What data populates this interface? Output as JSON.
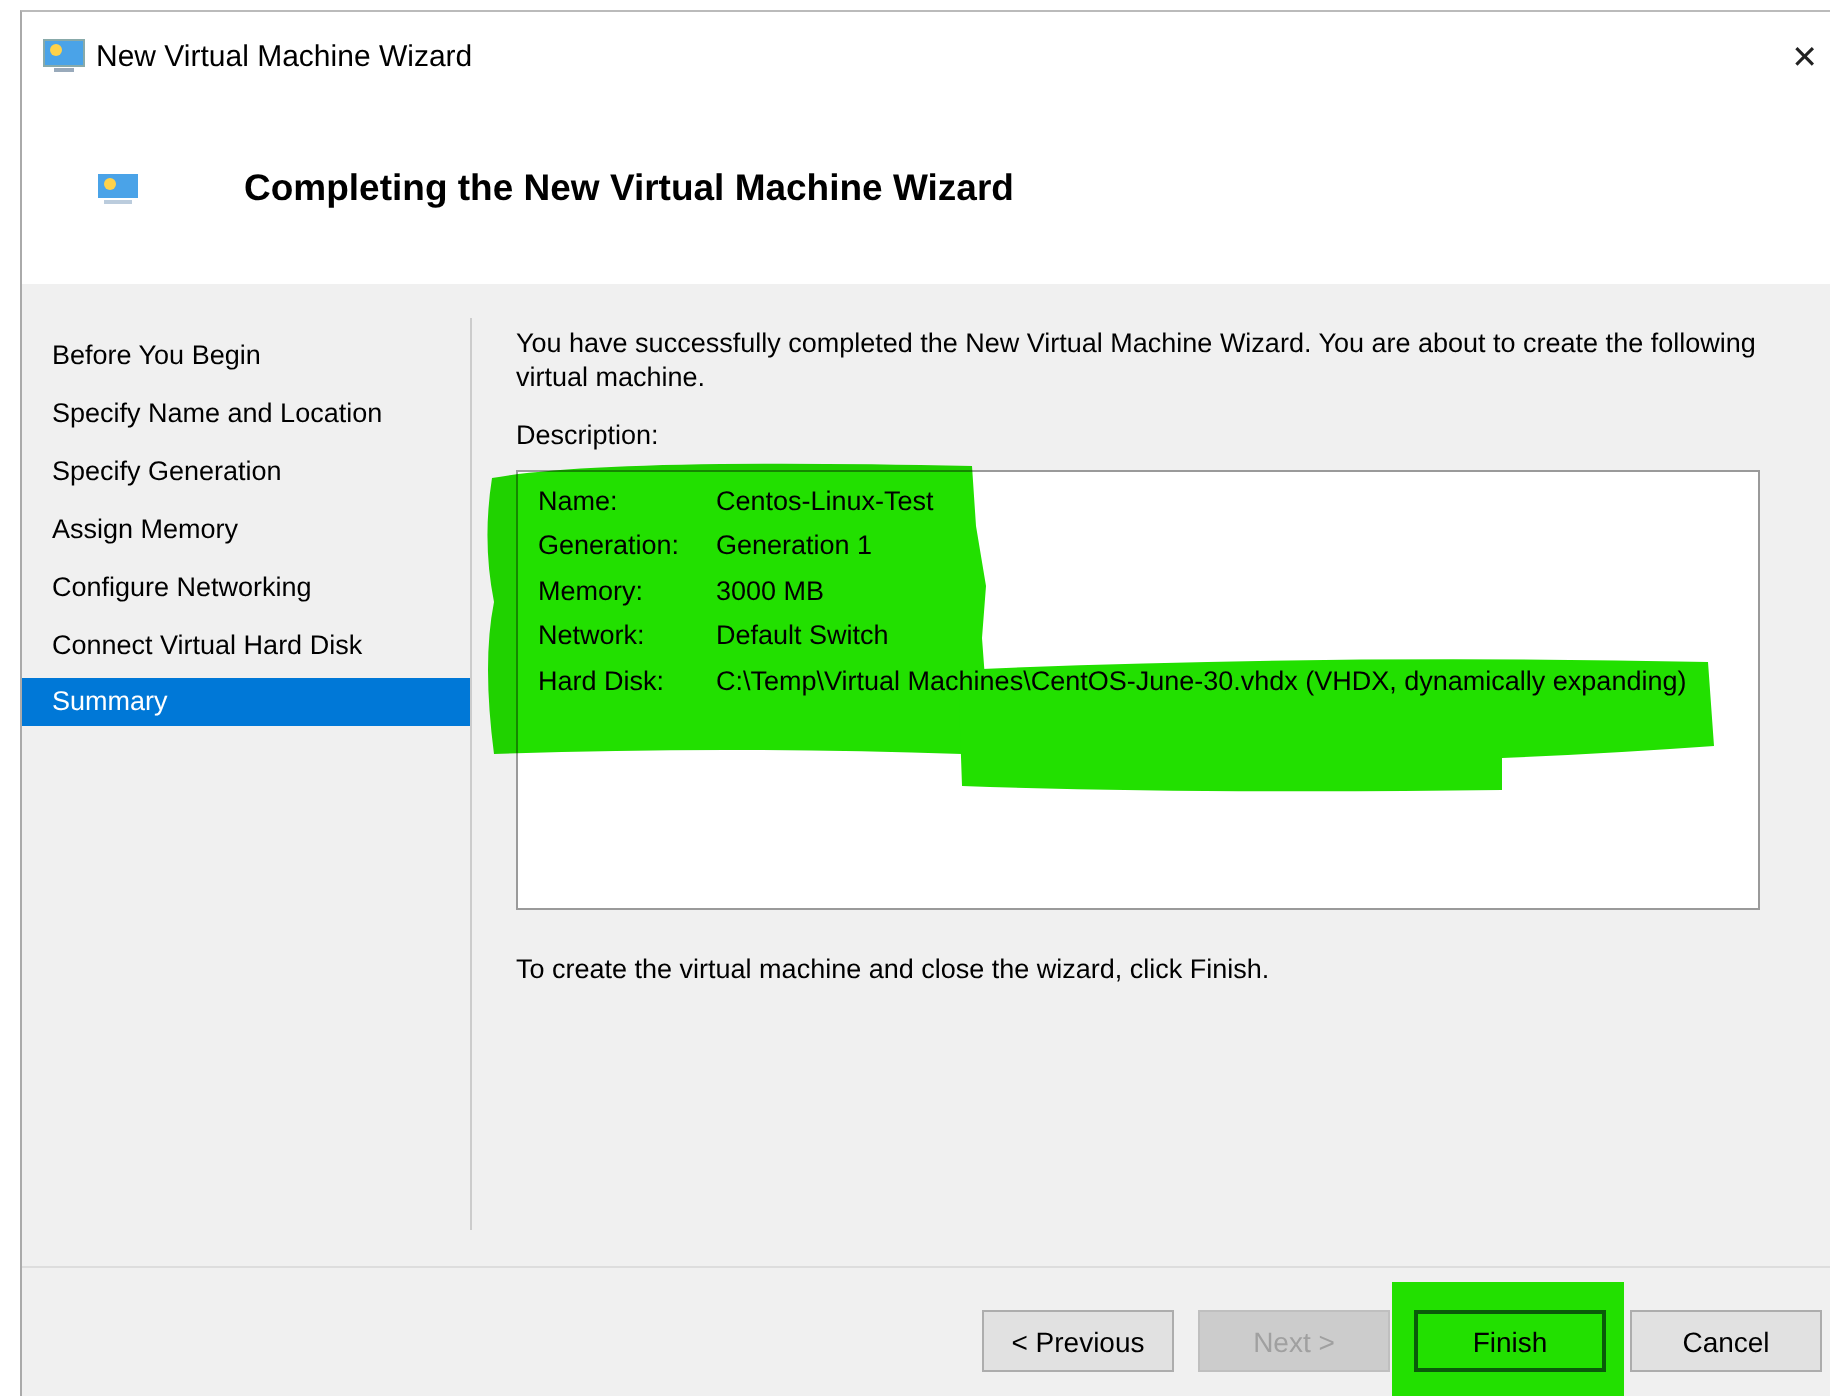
{
  "window": {
    "title": "New Virtual Machine Wizard",
    "close": "✕"
  },
  "header": {
    "title": "Completing the New Virtual Machine Wizard"
  },
  "steps": [
    {
      "label": "Before You Begin",
      "selected": false
    },
    {
      "label": "Specify Name and Location",
      "selected": false
    },
    {
      "label": "Specify Generation",
      "selected": false
    },
    {
      "label": "Assign Memory",
      "selected": false
    },
    {
      "label": "Configure Networking",
      "selected": false
    },
    {
      "label": "Connect Virtual Hard Disk",
      "selected": false
    },
    {
      "label": "Summary",
      "selected": true
    }
  ],
  "intro": "You have successfully completed the New Virtual Machine Wizard. You are about to create the following virtual machine.",
  "description": {
    "label": "Description:",
    "rows": [
      {
        "key": "Name:",
        "value": "Centos-Linux-Test"
      },
      {
        "key": "Generation:",
        "value": "Generation 1"
      },
      {
        "key": "Memory:",
        "value": "3000 MB"
      },
      {
        "key": "Network:",
        "value": "Default Switch"
      },
      {
        "key": "Hard Disk:",
        "value": "C:\\Temp\\Virtual Machines\\CentOS-June-30.vhdx (VHDX, dynamically expanding)"
      }
    ]
  },
  "footer_text": "To create the virtual machine and close the wizard, click Finish.",
  "buttons": [
    {
      "label": "< Previous",
      "disabled": false,
      "default": false
    },
    {
      "label": "Next >",
      "disabled": true,
      "default": false
    },
    {
      "label": "Finish",
      "disabled": false,
      "default": true,
      "marked": true
    },
    {
      "label": "Cancel",
      "disabled": false,
      "default": false
    }
  ],
  "annotations": [
    {
      "kind": "marker"
    },
    {
      "kind": "marker"
    }
  ]
}
